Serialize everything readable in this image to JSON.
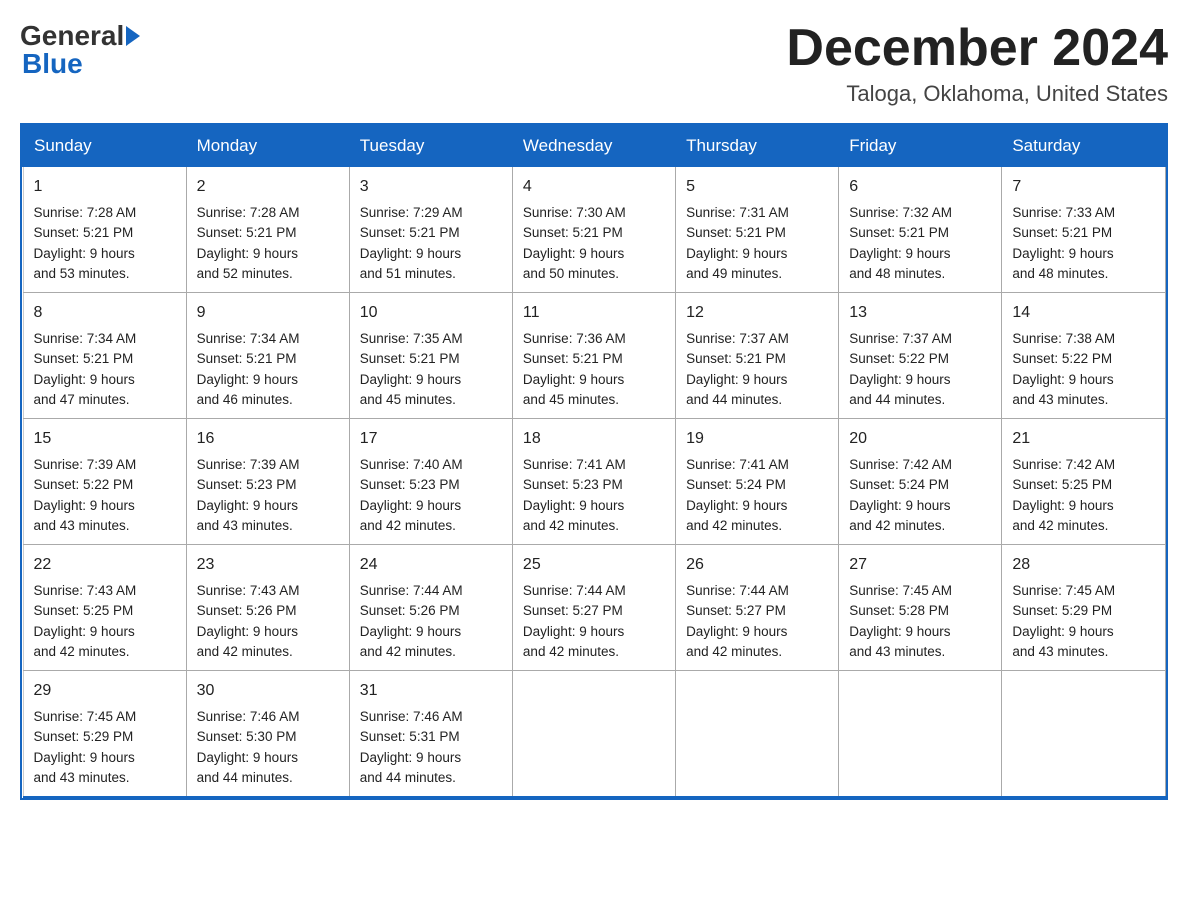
{
  "header": {
    "logo_general": "General",
    "logo_blue": "Blue",
    "month": "December 2024",
    "location": "Taloga, Oklahoma, United States"
  },
  "days_of_week": [
    "Sunday",
    "Monday",
    "Tuesday",
    "Wednesday",
    "Thursday",
    "Friday",
    "Saturday"
  ],
  "weeks": [
    [
      {
        "num": "1",
        "sunrise": "7:28 AM",
        "sunset": "5:21 PM",
        "daylight": "9 hours and 53 minutes."
      },
      {
        "num": "2",
        "sunrise": "7:28 AM",
        "sunset": "5:21 PM",
        "daylight": "9 hours and 52 minutes."
      },
      {
        "num": "3",
        "sunrise": "7:29 AM",
        "sunset": "5:21 PM",
        "daylight": "9 hours and 51 minutes."
      },
      {
        "num": "4",
        "sunrise": "7:30 AM",
        "sunset": "5:21 PM",
        "daylight": "9 hours and 50 minutes."
      },
      {
        "num": "5",
        "sunrise": "7:31 AM",
        "sunset": "5:21 PM",
        "daylight": "9 hours and 49 minutes."
      },
      {
        "num": "6",
        "sunrise": "7:32 AM",
        "sunset": "5:21 PM",
        "daylight": "9 hours and 48 minutes."
      },
      {
        "num": "7",
        "sunrise": "7:33 AM",
        "sunset": "5:21 PM",
        "daylight": "9 hours and 48 minutes."
      }
    ],
    [
      {
        "num": "8",
        "sunrise": "7:34 AM",
        "sunset": "5:21 PM",
        "daylight": "9 hours and 47 minutes."
      },
      {
        "num": "9",
        "sunrise": "7:34 AM",
        "sunset": "5:21 PM",
        "daylight": "9 hours and 46 minutes."
      },
      {
        "num": "10",
        "sunrise": "7:35 AM",
        "sunset": "5:21 PM",
        "daylight": "9 hours and 45 minutes."
      },
      {
        "num": "11",
        "sunrise": "7:36 AM",
        "sunset": "5:21 PM",
        "daylight": "9 hours and 45 minutes."
      },
      {
        "num": "12",
        "sunrise": "7:37 AM",
        "sunset": "5:21 PM",
        "daylight": "9 hours and 44 minutes."
      },
      {
        "num": "13",
        "sunrise": "7:37 AM",
        "sunset": "5:22 PM",
        "daylight": "9 hours and 44 minutes."
      },
      {
        "num": "14",
        "sunrise": "7:38 AM",
        "sunset": "5:22 PM",
        "daylight": "9 hours and 43 minutes."
      }
    ],
    [
      {
        "num": "15",
        "sunrise": "7:39 AM",
        "sunset": "5:22 PM",
        "daylight": "9 hours and 43 minutes."
      },
      {
        "num": "16",
        "sunrise": "7:39 AM",
        "sunset": "5:23 PM",
        "daylight": "9 hours and 43 minutes."
      },
      {
        "num": "17",
        "sunrise": "7:40 AM",
        "sunset": "5:23 PM",
        "daylight": "9 hours and 42 minutes."
      },
      {
        "num": "18",
        "sunrise": "7:41 AM",
        "sunset": "5:23 PM",
        "daylight": "9 hours and 42 minutes."
      },
      {
        "num": "19",
        "sunrise": "7:41 AM",
        "sunset": "5:24 PM",
        "daylight": "9 hours and 42 minutes."
      },
      {
        "num": "20",
        "sunrise": "7:42 AM",
        "sunset": "5:24 PM",
        "daylight": "9 hours and 42 minutes."
      },
      {
        "num": "21",
        "sunrise": "7:42 AM",
        "sunset": "5:25 PM",
        "daylight": "9 hours and 42 minutes."
      }
    ],
    [
      {
        "num": "22",
        "sunrise": "7:43 AM",
        "sunset": "5:25 PM",
        "daylight": "9 hours and 42 minutes."
      },
      {
        "num": "23",
        "sunrise": "7:43 AM",
        "sunset": "5:26 PM",
        "daylight": "9 hours and 42 minutes."
      },
      {
        "num": "24",
        "sunrise": "7:44 AM",
        "sunset": "5:26 PM",
        "daylight": "9 hours and 42 minutes."
      },
      {
        "num": "25",
        "sunrise": "7:44 AM",
        "sunset": "5:27 PM",
        "daylight": "9 hours and 42 minutes."
      },
      {
        "num": "26",
        "sunrise": "7:44 AM",
        "sunset": "5:27 PM",
        "daylight": "9 hours and 42 minutes."
      },
      {
        "num": "27",
        "sunrise": "7:45 AM",
        "sunset": "5:28 PM",
        "daylight": "9 hours and 43 minutes."
      },
      {
        "num": "28",
        "sunrise": "7:45 AM",
        "sunset": "5:29 PM",
        "daylight": "9 hours and 43 minutes."
      }
    ],
    [
      {
        "num": "29",
        "sunrise": "7:45 AM",
        "sunset": "5:29 PM",
        "daylight": "9 hours and 43 minutes."
      },
      {
        "num": "30",
        "sunrise": "7:46 AM",
        "sunset": "5:30 PM",
        "daylight": "9 hours and 44 minutes."
      },
      {
        "num": "31",
        "sunrise": "7:46 AM",
        "sunset": "5:31 PM",
        "daylight": "9 hours and 44 minutes."
      },
      null,
      null,
      null,
      null
    ]
  ],
  "labels": {
    "sunrise": "Sunrise:",
    "sunset": "Sunset:",
    "daylight": "Daylight:"
  }
}
